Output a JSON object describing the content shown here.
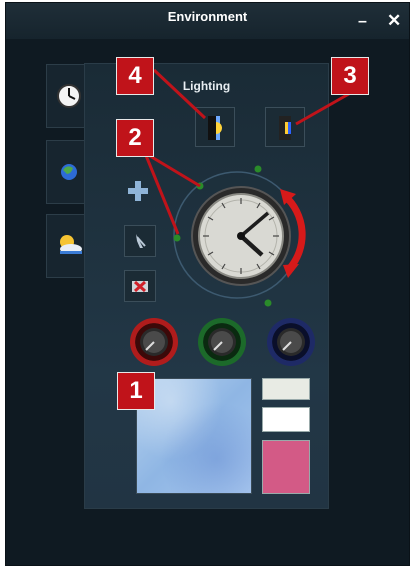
{
  "window": {
    "title": "Environment",
    "minimize_label": "–",
    "close_label": "✕"
  },
  "panel": {
    "title": "Lighting"
  },
  "tabs": [
    {
      "icon": "clock-icon"
    },
    {
      "icon": "globe-icon"
    },
    {
      "icon": "weather-icon"
    }
  ],
  "tools": [
    {
      "icon": "plus-icon"
    },
    {
      "icon": "cursor-icon"
    },
    {
      "icon": "delete-icon"
    }
  ],
  "knobs": [
    {
      "color": "#b01c1c"
    },
    {
      "color": "#1c6a2a"
    },
    {
      "color": "#1e2a66"
    }
  ],
  "swatches": {
    "big": "#9fc3ea",
    "small": [
      "#e8ebe4",
      "#ffffff",
      "#d35a86"
    ]
  },
  "callouts": [
    "1",
    "2",
    "3",
    "4"
  ],
  "colors": {
    "accent_red": "#c0131a",
    "clock_ring": "#cc1a1a"
  }
}
